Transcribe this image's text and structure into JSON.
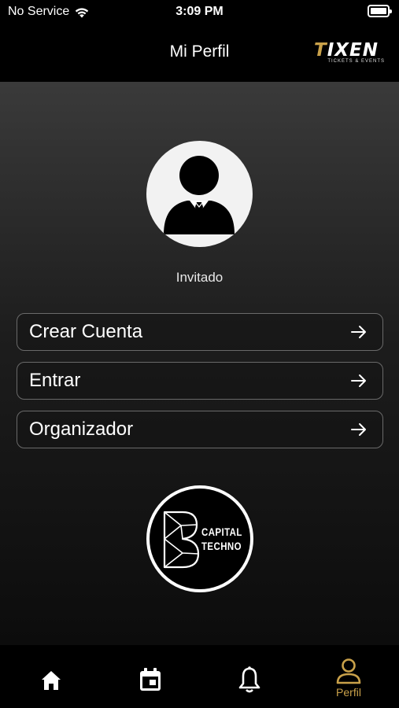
{
  "status": {
    "carrier": "No Service",
    "time": "3:09 PM",
    "icons": [
      "wifi-icon",
      "battery-icon"
    ]
  },
  "nav": {
    "title": "Mi Perfil",
    "brand": {
      "name": "TIXEN",
      "tagline": "TICKETS & EVENTS"
    }
  },
  "profile": {
    "avatar_icon": "person-suit-icon",
    "name": "Invitado"
  },
  "menu": [
    {
      "label": "Crear Cuenta",
      "icon": "arrow-right-icon"
    },
    {
      "label": "Entrar",
      "icon": "arrow-right-icon"
    },
    {
      "label": "Organizador",
      "icon": "arrow-right-icon"
    }
  ],
  "organizer_logo": {
    "line1": "CAPITAL",
    "line2": "TECHNO"
  },
  "tabs": [
    {
      "icon": "home-icon",
      "label": ""
    },
    {
      "icon": "calendar-icon",
      "label": ""
    },
    {
      "icon": "bell-icon",
      "label": ""
    },
    {
      "icon": "person-icon",
      "label": "Perfil",
      "active": true
    }
  ],
  "colors": {
    "accent": "#c9a14a",
    "background": "#000000",
    "text": "#ffffff"
  }
}
